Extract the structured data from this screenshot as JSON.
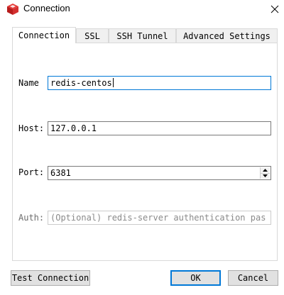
{
  "window": {
    "title": "Connection",
    "icon": "redis-cube-icon",
    "close": "close-icon"
  },
  "tabs": [
    {
      "label": "Connection",
      "active": true
    },
    {
      "label": "SSL",
      "active": false
    },
    {
      "label": "SSH Tunnel",
      "active": false
    },
    {
      "label": "Advanced Settings",
      "active": false
    }
  ],
  "form": {
    "name": {
      "label": "Name",
      "value": "redis-centos"
    },
    "host": {
      "label": "Host:",
      "value": "127.0.0.1"
    },
    "port": {
      "label": "Port:",
      "value": "6381"
    },
    "auth": {
      "label": "Auth:",
      "placeholder": "(Optional) redis-server authentication pas",
      "enabled": false
    }
  },
  "buttons": {
    "test": "Test Connection",
    "ok": "OK",
    "cancel": "Cancel"
  },
  "colors": {
    "accent": "#0078d7",
    "icon_red": "#d32f2f"
  }
}
